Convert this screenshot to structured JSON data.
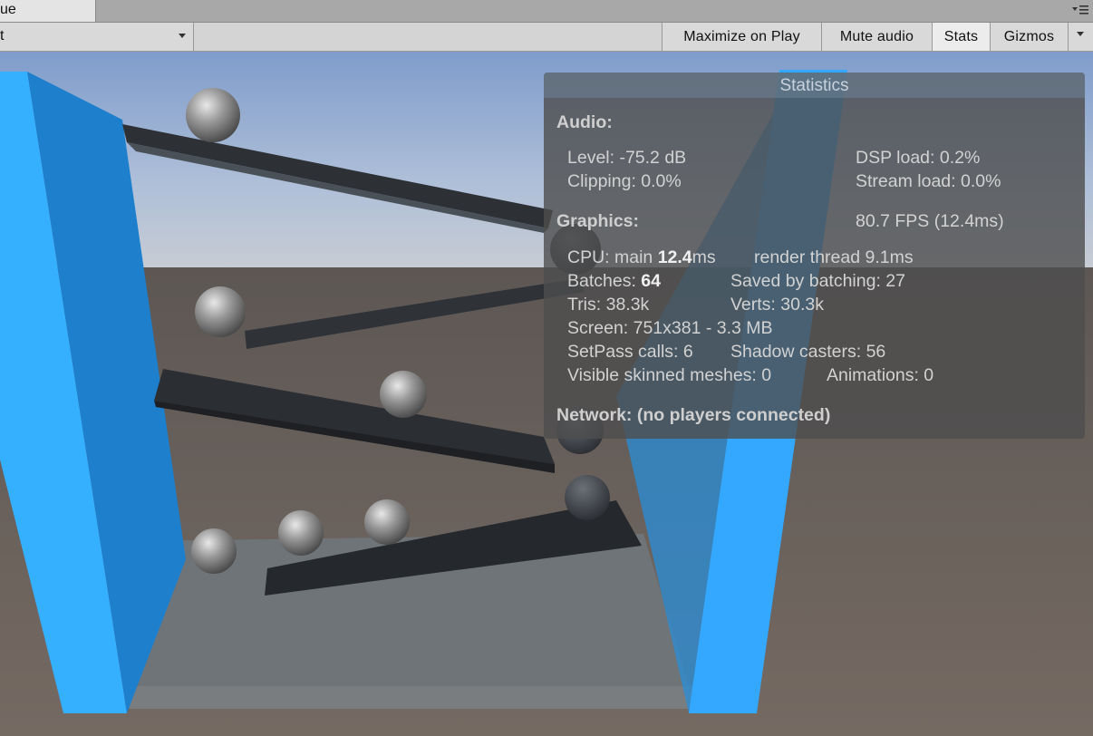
{
  "tab": {
    "label": "ue"
  },
  "toolbar": {
    "aspect_value": "t",
    "maximize_on_play": "Maximize on Play",
    "mute_audio": "Mute audio",
    "stats": "Stats",
    "gizmos": "Gizmos"
  },
  "stats": {
    "title": "Statistics",
    "audio_heading": "Audio:",
    "level": "Level: -75.2 dB",
    "dsp_load": "DSP load: 0.2%",
    "clipping": "Clipping: 0.0%",
    "stream_load": "Stream load: 0.0%",
    "graphics_heading": "Graphics:",
    "fps": "80.7 FPS (12.4ms)",
    "cpu_main_label": "CPU: main ",
    "cpu_main_value": "12.4",
    "cpu_main_unit": "ms",
    "render_thread": "render thread 9.1ms",
    "batches_label": "Batches: ",
    "batches_value": "64",
    "saved_by_batching": "Saved by batching: 27",
    "tris": "Tris: 38.3k",
    "verts": "Verts: 30.3k",
    "screen": "Screen: 751x381 - 3.3 MB",
    "setpass": "SetPass calls: 6",
    "shadow_casters": "Shadow casters: 56",
    "visible_skinned": "Visible skinned meshes: 0",
    "animations": "Animations: 0",
    "network": "Network: (no players connected)"
  },
  "colors": {
    "wall_blue": "#3aa8ff",
    "sky": "#9ab4d6",
    "ground": "#6e645e",
    "ramp": "#2e3136",
    "ball": "#8c8c8c"
  }
}
